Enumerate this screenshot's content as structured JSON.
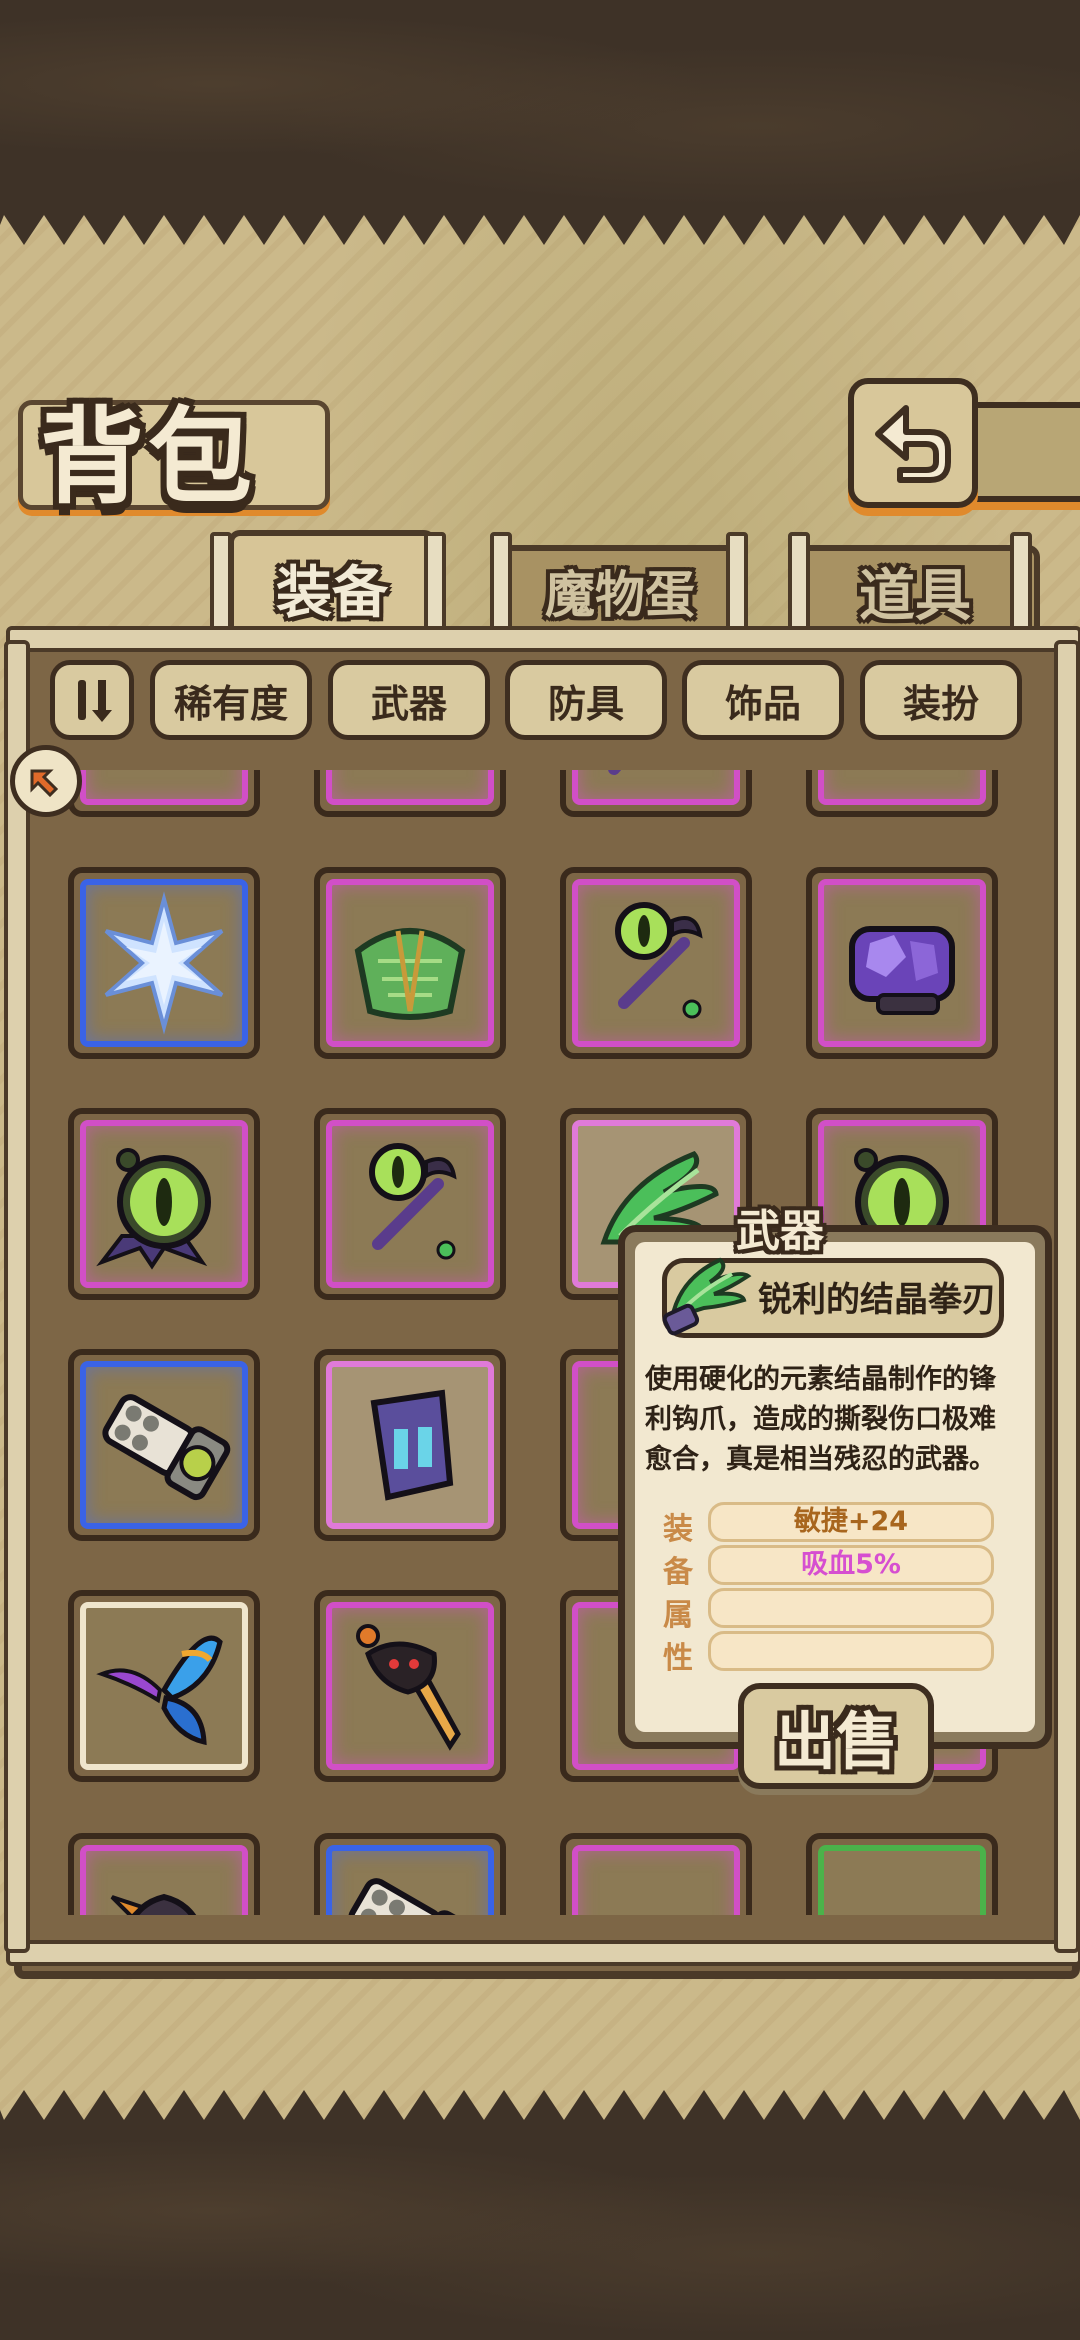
{
  "header": {
    "title": "背包",
    "back_icon": "return-arrow-icon"
  },
  "tabs": [
    {
      "label": "装备",
      "active": true
    },
    {
      "label": "魔物蛋",
      "active": false
    },
    {
      "label": "道具",
      "active": false
    }
  ],
  "filters": {
    "sort_icon": "sort-toggle-icon",
    "buttons": [
      "稀有度",
      "武器",
      "防具",
      "饰品",
      "装扮"
    ]
  },
  "inventory": {
    "rarity_colors": {
      "purple": "#d14fc7",
      "blue": "#3a63e6",
      "white": "#efe5cc",
      "green": "#4bb24a"
    },
    "items": [
      {
        "icon": "dark-helmet-icon",
        "rarity": "purple"
      },
      {
        "icon": "dark-armor-icon",
        "rarity": "purple"
      },
      {
        "icon": "purple-staff-icon",
        "rarity": "purple"
      },
      {
        "icon": "feather-icon",
        "rarity": "purple"
      },
      {
        "icon": "ice-crystal-icon",
        "rarity": "blue"
      },
      {
        "icon": "scale-armor-icon",
        "rarity": "purple"
      },
      {
        "icon": "eye-staff-icon",
        "rarity": "purple"
      },
      {
        "icon": "amethyst-gauntlet-icon",
        "rarity": "purple"
      },
      {
        "icon": "eye-amulet-icon",
        "rarity": "purple"
      },
      {
        "icon": "eye-staff-icon",
        "rarity": "purple"
      },
      {
        "icon": "crystal-claw-icon",
        "rarity": "pink"
      },
      {
        "icon": "eye-amulet-icon",
        "rarity": "purple"
      },
      {
        "icon": "gatling-gun-icon",
        "rarity": "blue"
      },
      {
        "icon": "rune-bracer-icon",
        "rarity": "pink"
      },
      {
        "icon": "hidden-item",
        "rarity": "purple"
      },
      {
        "icon": "hidden-item",
        "rarity": "purple"
      },
      {
        "icon": "butterfly-wing-icon",
        "rarity": "white"
      },
      {
        "icon": "demon-sword-icon",
        "rarity": "purple"
      },
      {
        "icon": "hidden-item",
        "rarity": "purple"
      },
      {
        "icon": "hidden-item",
        "rarity": "purple"
      },
      {
        "icon": "dark-helmet-icon",
        "rarity": "purple"
      },
      {
        "icon": "gatling-gun-icon",
        "rarity": "blue"
      },
      {
        "icon": "water-bucket-icon",
        "rarity": "purple"
      },
      {
        "icon": "red-item-icon",
        "rarity": "green"
      }
    ]
  },
  "tooltip": {
    "category": "武器",
    "name": "锐利的结晶拳刃",
    "icon": "crystal-claw-icon",
    "description": "使用硬化的元素结晶制作的锋利钩爪，造成的撕裂伤口极难愈合，真是相当残忍的武器。",
    "attr_heading": [
      "装",
      "备",
      "属",
      "性"
    ],
    "attributes": [
      {
        "text": "敏捷+24",
        "color": "#a8661e"
      },
      {
        "text": "吸血5%",
        "color": "#d64fd0"
      },
      {
        "text": "",
        "color": "#a8661e"
      },
      {
        "text": "",
        "color": "#a8661e"
      }
    ],
    "sell_label": "出售"
  }
}
